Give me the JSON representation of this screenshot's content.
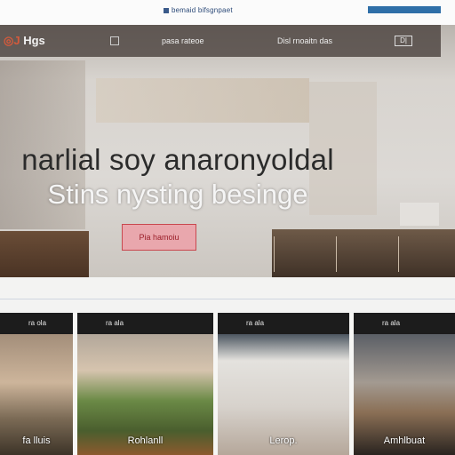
{
  "topbar": {
    "utility_link": "bemaid bifsgnpaet",
    "button_label": ""
  },
  "nav": {
    "logo_text": "Hgs",
    "links": [
      "pasa rateoe",
      "Disl rnoaitn das"
    ],
    "menu_box": "D|"
  },
  "hero": {
    "headline": "narlial soy anaronyoldal",
    "subline": "Stins nysting besinge",
    "cta_label": "Pia hamoiu"
  },
  "cards": [
    {
      "header": "ra ola",
      "caption": "fa lluis"
    },
    {
      "header": "ra ala",
      "caption": "Rohlanll"
    },
    {
      "header": "ra ala",
      "caption": "Lerop."
    },
    {
      "header": "ra ala",
      "caption": "Amhlbuat"
    }
  ],
  "colors": {
    "accent_red": "#c9484f",
    "cta_fill": "#e9a7ad",
    "util_button": "#2f6fa8",
    "nav_bg": "#463e3a"
  }
}
